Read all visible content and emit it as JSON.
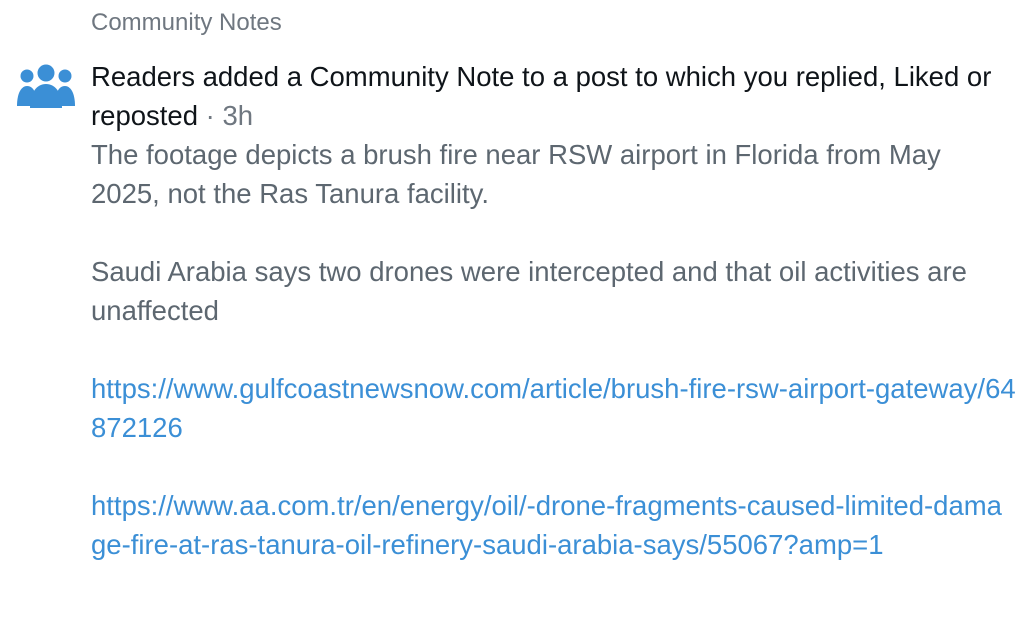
{
  "notification": {
    "section_label": "Community Notes",
    "icon": "people-group-icon",
    "accent_color": "#3b8fd6",
    "headline": "Readers added a Community Note to a post to which you replied, Liked or reposted",
    "separator": " · ",
    "timestamp": "3h",
    "note_paragraphs": [
      "The footage depicts a brush fire near RSW airport in Florida from May 2025, not the Ras Tanura facility.",
      "Saudi Arabia says two drones were intercepted and that oil activities are unaffected"
    ],
    "links": [
      "https://www.gulfcoastnewsnow.com/article/brush-fire-rsw-airport-gateway/64872126",
      "https://www.aa.com.tr/en/energy/oil/-drone-fragments-caused-limited-damage-fire-at-ras-tanura-oil-refinery-saudi-arabia-says/55067?amp=1"
    ]
  }
}
